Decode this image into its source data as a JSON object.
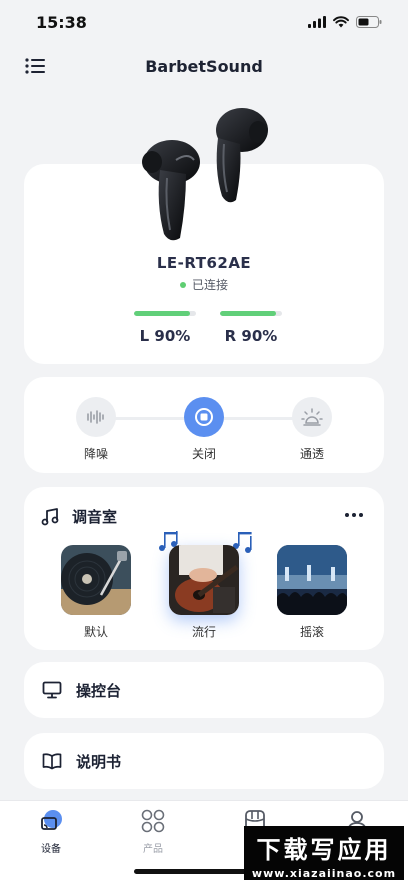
{
  "status": {
    "time": "15:38"
  },
  "nav": {
    "title": "BarbetSound"
  },
  "device": {
    "name": "LE-RT62AE",
    "connection_status": "已连接",
    "left": {
      "label": "L 90%",
      "level": 0.9
    },
    "right": {
      "label": "R 90%",
      "level": 0.9
    }
  },
  "modes": [
    {
      "label": "降噪",
      "icon": "waveform-icon",
      "active": false
    },
    {
      "label": "关闭",
      "icon": "stop-icon",
      "active": true
    },
    {
      "label": "通透",
      "icon": "sun-icon",
      "active": false
    }
  ],
  "studio": {
    "title": "调音室",
    "presets": [
      {
        "label": "默认",
        "active": false
      },
      {
        "label": "流行",
        "active": true
      },
      {
        "label": "摇滚",
        "active": false
      }
    ]
  },
  "console": {
    "label": "操控台"
  },
  "manual": {
    "label": "说明书"
  },
  "tabs": [
    {
      "label": "设备",
      "icon": "device-icon",
      "active": true
    },
    {
      "label": "产品",
      "icon": "grid-icon",
      "active": false
    },
    {
      "label": "",
      "icon": "store-icon",
      "active": false
    },
    {
      "label": "",
      "icon": "profile-icon",
      "active": false
    }
  ],
  "watermark": {
    "title": "下载写应用",
    "url": "www.xiazaiinao.com"
  },
  "colors": {
    "accent": "#5b8ff0",
    "battery": "#61cf79",
    "background": "#f2f3f5"
  }
}
